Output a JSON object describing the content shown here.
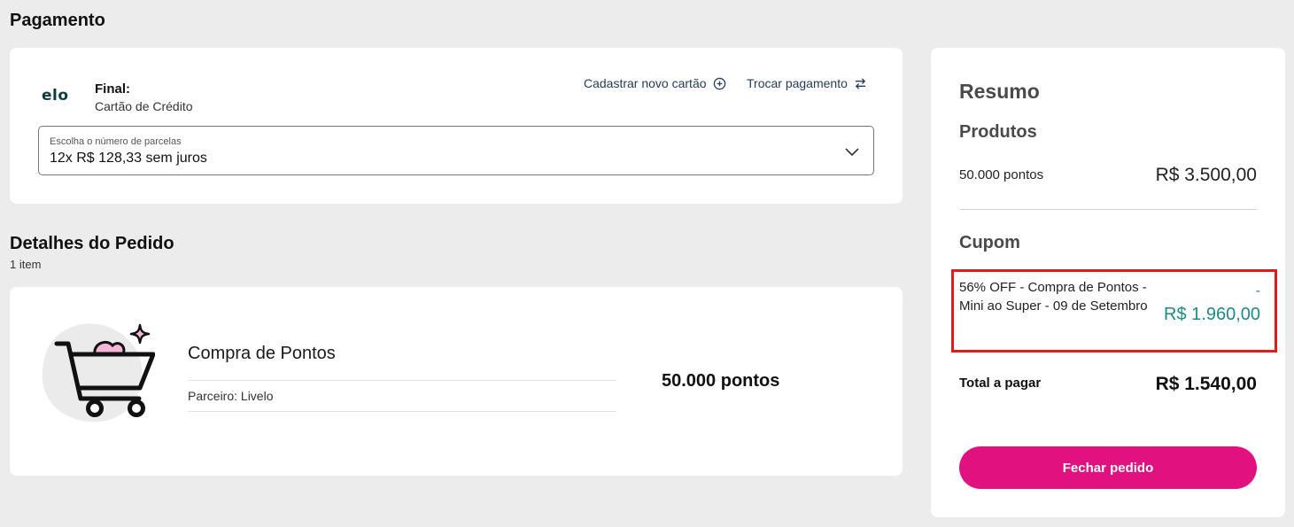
{
  "payment": {
    "title": "Pagamento",
    "card_brand": "elo",
    "card_final_label": "Final:",
    "card_type": "Cartão de Crédito",
    "new_card_link": "Cadastrar novo cartão",
    "switch_payment_link": "Trocar pagamento",
    "installments_label": "Escolha o número de parcelas",
    "installments_value": "12x R$ 128,33 sem juros"
  },
  "order": {
    "title": "Detalhes do Pedido",
    "items_count": "1 item",
    "product_name": "Compra de Pontos",
    "partner": "Parceiro: Livelo",
    "quantity": "50.000 pontos"
  },
  "summary": {
    "title": "Resumo",
    "products_heading": "Produtos",
    "product_label": "50.000 pontos",
    "product_value": "R$ 3.500,00",
    "coupon_heading": "Cupom",
    "coupon_text": "56% OFF - Compra de Pontos - Mini ao Super - 09 de Setembro",
    "coupon_sign": "-",
    "coupon_value": "R$ 1.960,00",
    "total_label": "Total a pagar",
    "total_value": "R$ 1.540,00",
    "checkout_button": "Fechar pedido"
  },
  "colors": {
    "brand_pink": "#e1117f",
    "discount_teal": "#1e8a86",
    "highlight_red": "#e01b1b",
    "link_navy": "#263b5c"
  },
  "icons": [
    "elo-logo",
    "plus-circle-icon",
    "swap-arrows-icon",
    "chevron-down-icon",
    "shopping-cart-icon",
    "sparkle-icon"
  ]
}
